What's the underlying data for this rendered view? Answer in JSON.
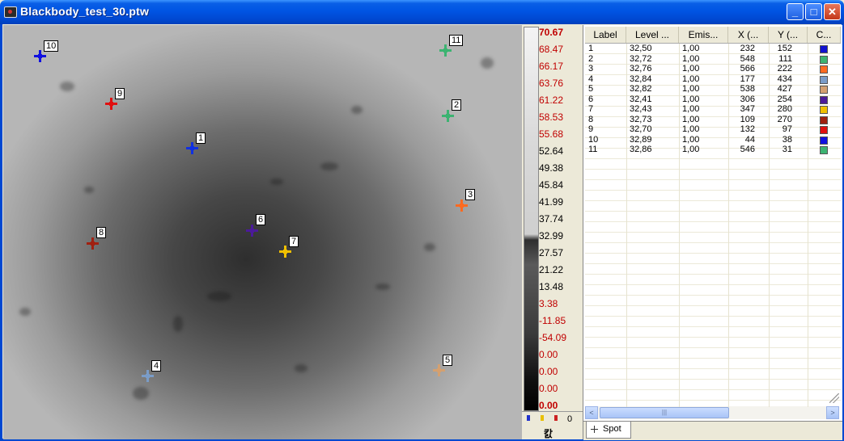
{
  "window": {
    "title": "Blackbody_test_30.ptw",
    "minimize": "_",
    "maximize": "□",
    "close": "✕"
  },
  "colors": {
    "title_bar": "#0054E3",
    "scale_red": "#C00000",
    "scale_black": "#000000"
  },
  "markers": [
    {
      "label": "10",
      "color": "#1010E0"
    },
    {
      "label": "11",
      "color": "#3CB371"
    },
    {
      "label": "9",
      "color": "#E01010"
    },
    {
      "label": "2",
      "color": "#3CB371"
    },
    {
      "label": "1",
      "color": "#1030E0"
    },
    {
      "label": "3",
      "color": "#FF6A20"
    },
    {
      "label": "6",
      "color": "#4B1A9A"
    },
    {
      "label": "7",
      "color": "#F0C000"
    },
    {
      "label": "8",
      "color": "#A02010"
    },
    {
      "label": "4",
      "color": "#7A9CC8"
    },
    {
      "label": "5",
      "color": "#D4A070"
    }
  ],
  "palette": {
    "scale": [
      {
        "v": "70.67",
        "c": "#C00000",
        "b": true
      },
      {
        "v": "68.47",
        "c": "#C00000"
      },
      {
        "v": "66.17",
        "c": "#C00000"
      },
      {
        "v": "63.76",
        "c": "#C00000"
      },
      {
        "v": "61.22",
        "c": "#C00000"
      },
      {
        "v": "58.53",
        "c": "#C00000"
      },
      {
        "v": "55.68",
        "c": "#C00000"
      },
      {
        "v": "52.64",
        "c": "#000000"
      },
      {
        "v": "49.38",
        "c": "#000000"
      },
      {
        "v": "45.84",
        "c": "#000000"
      },
      {
        "v": "41.99",
        "c": "#000000"
      },
      {
        "v": "37.74",
        "c": "#000000"
      },
      {
        "v": "32.99",
        "c": "#000000"
      },
      {
        "v": "27.57",
        "c": "#000000"
      },
      {
        "v": "21.22",
        "c": "#000000"
      },
      {
        "v": "13.48",
        "c": "#000000"
      },
      {
        "v": "3.38",
        "c": "#C00000"
      },
      {
        "v": "-11.85",
        "c": "#C00000"
      },
      {
        "v": "-54.09",
        "c": "#C00000"
      },
      {
        "v": "0.00",
        "c": "#C00000"
      },
      {
        "v": "0.00",
        "c": "#C00000"
      },
      {
        "v": "0.00",
        "c": "#C00000"
      },
      {
        "v": "0.00",
        "c": "#C00000",
        "b": true
      }
    ],
    "footer_value": "0",
    "unit": "캀"
  },
  "table": {
    "columns": [
      "Label",
      "Level ...",
      "Emis...",
      "X (...",
      "Y (...",
      "C..."
    ],
    "rows": [
      {
        "label": "1",
        "level": "32,50",
        "emis": "1,00",
        "x": "232",
        "y": "152",
        "color": "#1010D0"
      },
      {
        "label": "2",
        "level": "32,72",
        "emis": "1,00",
        "x": "548",
        "y": "111",
        "color": "#3CB371"
      },
      {
        "label": "3",
        "level": "32,76",
        "emis": "1,00",
        "x": "566",
        "y": "222",
        "color": "#FF6A20"
      },
      {
        "label": "4",
        "level": "32,84",
        "emis": "1,00",
        "x": "177",
        "y": "434",
        "color": "#7A9CC8"
      },
      {
        "label": "5",
        "level": "32,82",
        "emis": "1,00",
        "x": "538",
        "y": "427",
        "color": "#D4A070"
      },
      {
        "label": "6",
        "level": "32,41",
        "emis": "1,00",
        "x": "306",
        "y": "254",
        "color": "#4B1A9A"
      },
      {
        "label": "7",
        "level": "32,43",
        "emis": "1,00",
        "x": "347",
        "y": "280",
        "color": "#F0C000"
      },
      {
        "label": "8",
        "level": "32,73",
        "emis": "1,00",
        "x": "109",
        "y": "270",
        "color": "#A02010"
      },
      {
        "label": "9",
        "level": "32,70",
        "emis": "1,00",
        "x": "132",
        "y": "97",
        "color": "#E01010"
      },
      {
        "label": "10",
        "level": "32,89",
        "emis": "1,00",
        "x": "44",
        "y": "38",
        "color": "#1010E0"
      },
      {
        "label": "11",
        "level": "32,86",
        "emis": "1,00",
        "x": "546",
        "y": "31",
        "color": "#3CB371"
      }
    ]
  },
  "scrollbar": {
    "left": "<",
    "right": ">",
    "grip": "|||"
  },
  "tabs": {
    "spot": "Spot"
  }
}
